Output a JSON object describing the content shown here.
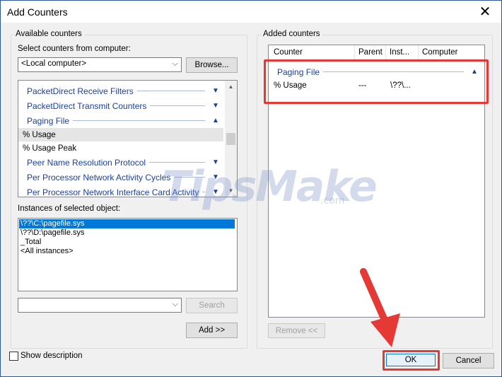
{
  "window": {
    "title": "Add Counters"
  },
  "available": {
    "group_label": "Available counters",
    "select_label": "Select counters from computer:",
    "computer_value": "<Local computer>",
    "browse_label": "Browse...",
    "counters": [
      {
        "type": "category",
        "label": "PacketDirect Receive Filters",
        "expanded": false
      },
      {
        "type": "category",
        "label": "PacketDirect Transmit Counters",
        "expanded": false
      },
      {
        "type": "category",
        "label": "Paging File",
        "expanded": true
      },
      {
        "type": "item",
        "label": "% Usage",
        "selected": true
      },
      {
        "type": "item",
        "label": "% Usage Peak",
        "selected": false
      },
      {
        "type": "category",
        "label": "Peer Name Resolution Protocol",
        "expanded": false
      },
      {
        "type": "category",
        "label": "Per Processor Network Activity Cycles",
        "expanded": false
      },
      {
        "type": "category",
        "label": "Per Processor Network Interface Card Activity",
        "expanded": false
      }
    ],
    "instances_label": "Instances of selected object:",
    "instances": [
      "\\??\\C:\\pagefile.sys",
      "\\??\\D:\\pagefile.sys",
      "_Total",
      "<All instances>"
    ],
    "search_value": "",
    "search_label": "Search",
    "add_label": "Add >>"
  },
  "added": {
    "group_label": "Added counters",
    "columns": [
      "Counter",
      "Parent",
      "Inst...",
      "Computer"
    ],
    "category": "Paging File",
    "rows": [
      {
        "counter": "% Usage",
        "parent": "---",
        "instance": "\\??\\...",
        "computer": ""
      }
    ],
    "remove_label": "Remove <<"
  },
  "show_description_label": "Show description",
  "ok_label": "OK",
  "cancel_label": "Cancel",
  "watermark": {
    "text": "TipsMake",
    "suffix": ".com"
  },
  "colors": {
    "highlight": "#e53935",
    "accent": "#0078d7",
    "category_text": "#1a3f9e"
  }
}
